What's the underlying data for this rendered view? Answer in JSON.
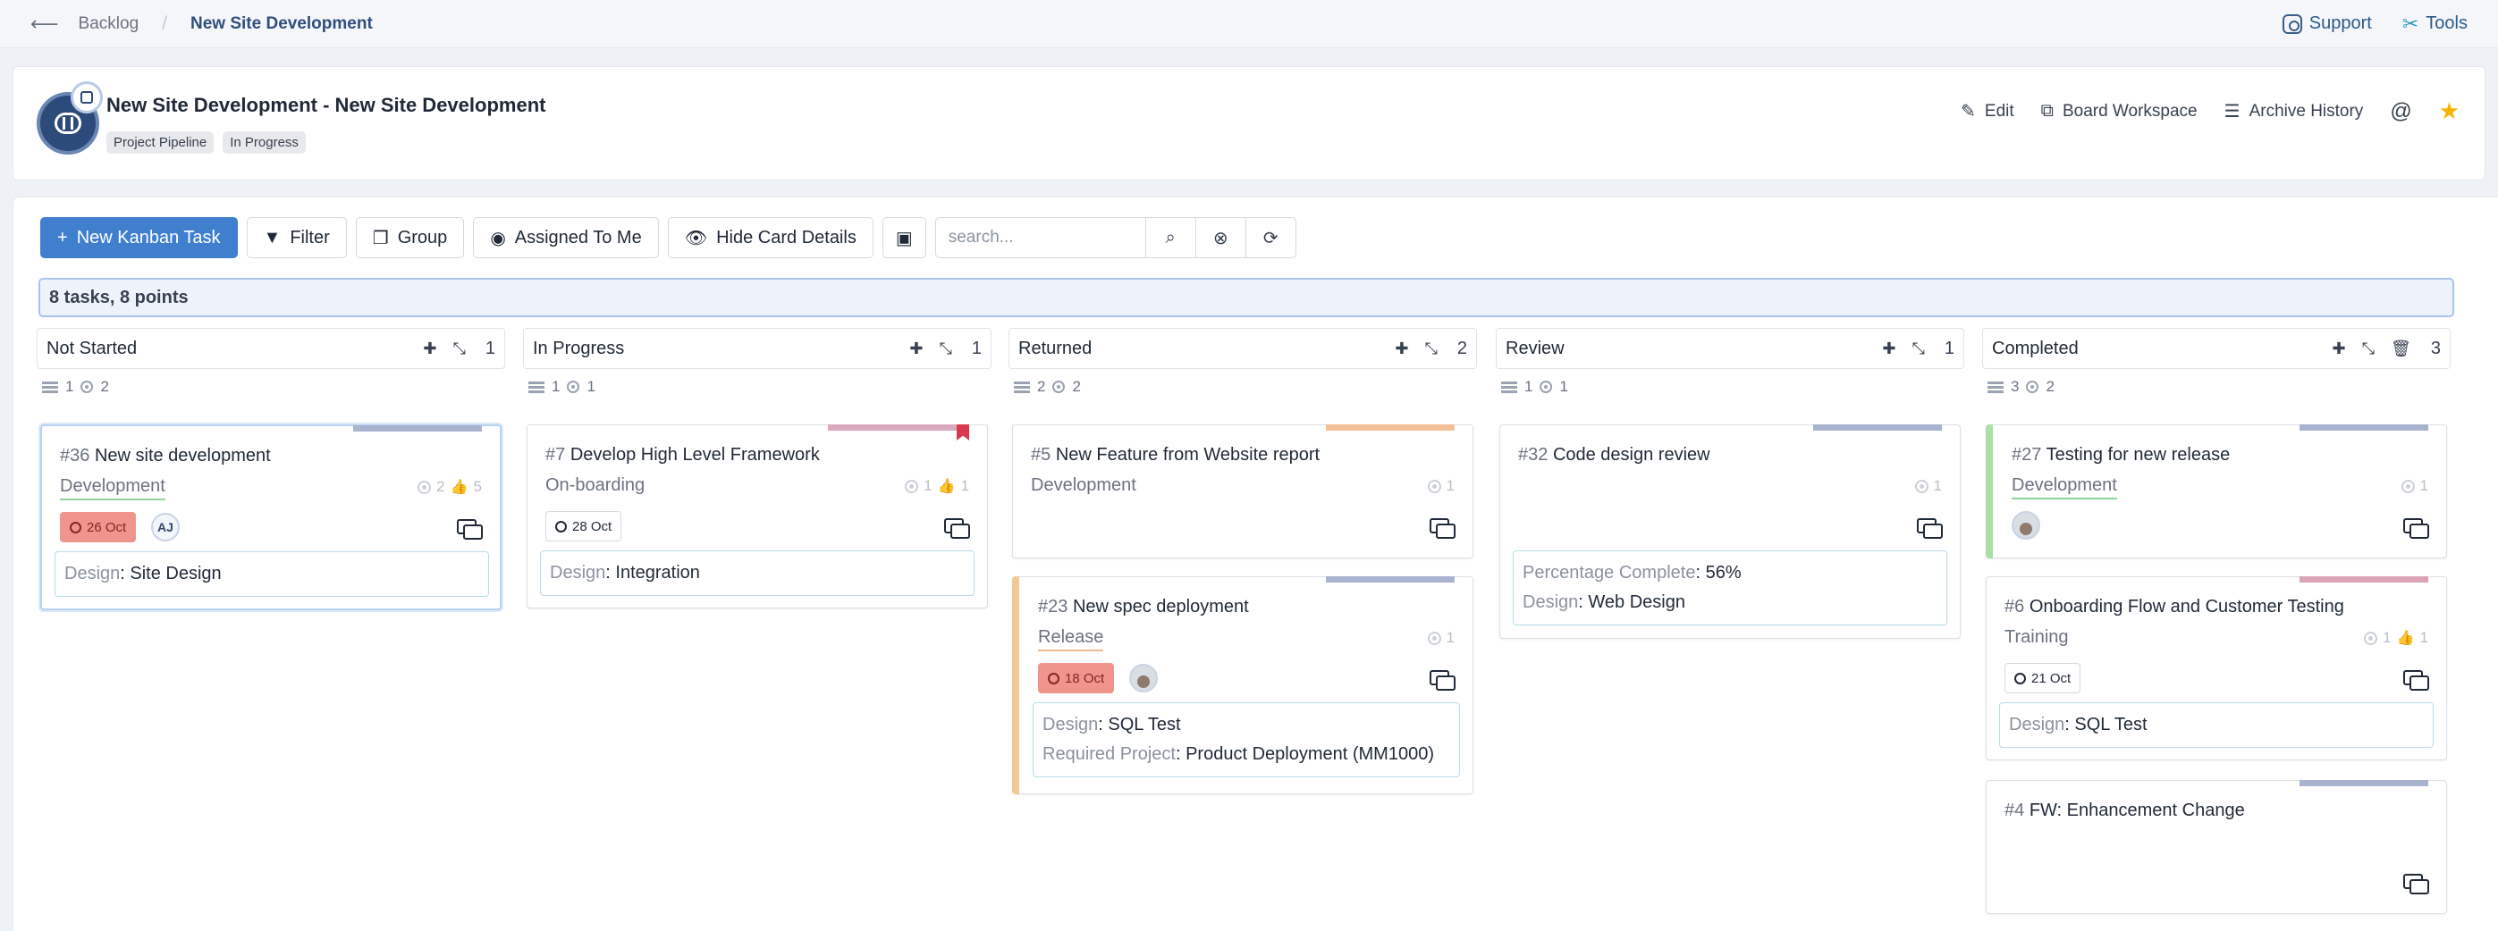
{
  "topbar": {
    "back_icon": "arrow-left-icon",
    "breadcrumb_parent": "Backlog",
    "breadcrumb_separator": "/",
    "breadcrumb_current": "New Site Development",
    "support_label": "Support",
    "tools_label": "Tools"
  },
  "header": {
    "title": "New Site Development - New Site Development",
    "tags": [
      "Project Pipeline",
      "In Progress"
    ],
    "actions": {
      "edit": "Edit",
      "workspace": "Board Workspace",
      "archive": "Archive History"
    },
    "star_color": "#f5b400"
  },
  "toolbar": {
    "new_task": "New Kanban Task",
    "filter": "Filter",
    "group": "Group",
    "assigned": "Assigned To Me",
    "hide_details": "Hide Card Details",
    "search_placeholder": "search..."
  },
  "summary": "8 tasks, 8 points",
  "columns": [
    {
      "title": "Not Started",
      "count": "1",
      "stats_tasks": "1",
      "stats_points": "2",
      "cards": [
        {
          "num": "#36",
          "title": "New site development",
          "category": "Development",
          "points": "2",
          "likes": "5",
          "date": "26 Oct",
          "avatar": "AJ",
          "detail": [
            {
              "k": "Design",
              "v": "Site Design"
            }
          ],
          "bar_color": "#a8b3d0"
        }
      ]
    },
    {
      "title": "In Progress",
      "count": "1",
      "stats_tasks": "1",
      "stats_points": "1",
      "cards": [
        {
          "num": "#7",
          "title": "Develop High Level Framework",
          "category": "On-boarding",
          "points": "1",
          "likes": "1",
          "date": "28 Oct",
          "detail": [
            {
              "k": "Design",
              "v": "Integration"
            }
          ],
          "bar_color": "#d9a9bd",
          "flag_color": "#d8394e"
        }
      ]
    },
    {
      "title": "Returned",
      "count": "2",
      "stats_tasks": "2",
      "stats_points": "2",
      "cards": [
        {
          "num": "#5",
          "title": "New Feature from Website report",
          "category": "Development",
          "points": "1",
          "bar_color": "#f2bf96"
        },
        {
          "num": "#23",
          "title": "New spec deployment",
          "category": "Release",
          "points": "1",
          "date": "18 Oct",
          "detail": [
            {
              "k": "Design",
              "v": "SQL Test"
            },
            {
              "k": "Required Project",
              "v": "Product Deployment (MM1000)"
            }
          ],
          "bar_color": "#a8b3d0",
          "left_color": "#f2c898"
        }
      ]
    },
    {
      "title": "Review",
      "count": "1",
      "stats_tasks": "1",
      "stats_points": "1",
      "cards": [
        {
          "num": "#32",
          "title": "Code design review",
          "points": "1",
          "detail": [
            {
              "k": "Percentage Complete",
              "v": "56%"
            },
            {
              "k": "Design",
              "v": "Web Design"
            }
          ],
          "bar_color": "#a8b3d0"
        }
      ]
    },
    {
      "title": "Completed",
      "count": "3",
      "stats_tasks": "3",
      "stats_points": "2",
      "cards": [
        {
          "num": "#27",
          "title": "Testing for new release",
          "category": "Development",
          "points": "1",
          "bar_color": "#a8b3d0",
          "left_color": "#a8e0a6"
        },
        {
          "num": "#6",
          "title": "Onboarding Flow and Customer Testing",
          "category": "Training",
          "points": "1",
          "likes": "1",
          "date": "21 Oct",
          "detail": [
            {
              "k": "Design",
              "v": "SQL Test"
            }
          ],
          "bar_color": "#dba4b8"
        },
        {
          "num": "#4",
          "title": "FW: Enhancement Change",
          "bar_color": "#a8b3d0"
        }
      ]
    }
  ]
}
